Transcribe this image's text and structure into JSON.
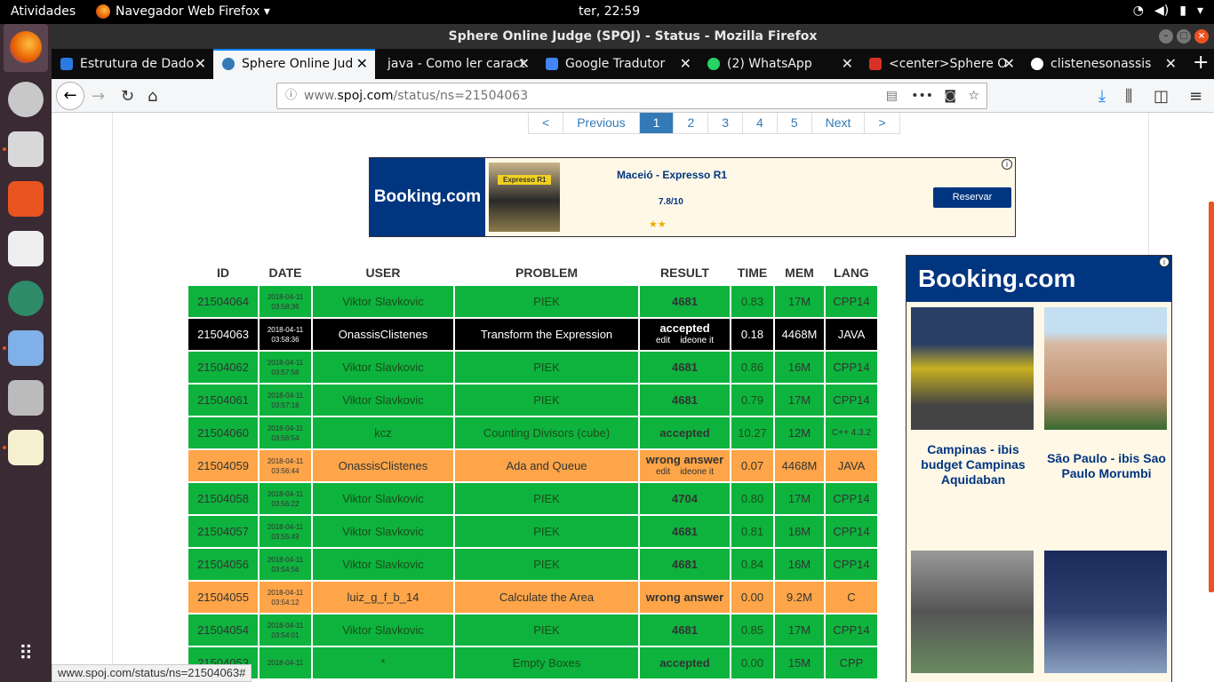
{
  "topbar": {
    "activities": "Atividades",
    "app_name": "Navegador Web Firefox ▾",
    "clock": "ter, 22:59"
  },
  "window": {
    "title": "Sphere Online Judge (SPOJ) - Status - Mozilla Firefox"
  },
  "tabs": [
    {
      "label": "Estrutura de Dado",
      "icon": "doc-icon",
      "color": "#2a7ae2"
    },
    {
      "label": "Sphere Online Jud",
      "icon": "spoj-icon",
      "color": "#337ab7",
      "active": true
    },
    {
      "label": "java - Como ler caract",
      "icon": "stackoverflow-icon",
      "color": "#0c0c0d"
    },
    {
      "label": "Google Tradutor",
      "icon": "translate-icon",
      "color": "#4285f4"
    },
    {
      "label": "(2) WhatsApp",
      "icon": "whatsapp-icon",
      "color": "#25d366"
    },
    {
      "label": "<center>Sphere O",
      "icon": "gmail-icon",
      "color": "#d93025"
    },
    {
      "label": "clistenesonassis",
      "icon": "github-icon",
      "color": "#ffffff"
    }
  ],
  "url": {
    "prefix": "www.",
    "host": "spoj.com",
    "path": "/status/ns=21504063"
  },
  "pagination": [
    "<",
    "Previous",
    "1",
    "2",
    "3",
    "4",
    "5",
    "Next",
    ">"
  ],
  "pagination_current": "1",
  "ad_top": {
    "brand": "Booking.com",
    "badge": "Expresso R1",
    "hotel": "Maceió - Expresso R1",
    "rating": "7.8/10",
    "stars": "★★",
    "button": "Reservar"
  },
  "table": {
    "headers": [
      "ID",
      "DATE",
      "USER",
      "PROBLEM",
      "RESULT",
      "TIME",
      "MEM",
      "LANG"
    ],
    "rows": [
      {
        "status": "ok",
        "id": "21504064",
        "date1": "2018-04-11",
        "date2": "03:58:36",
        "user": "Viktor Slavkovic",
        "problem": "PIEK",
        "result": "4681",
        "links": "",
        "time": "0.83",
        "mem": "17M",
        "lang": "CPP14"
      },
      {
        "status": "me",
        "id": "21504063",
        "date1": "2018-04-11",
        "date2": "03:58:36",
        "user": "OnassisClistenes",
        "problem": "Transform the Expression",
        "result": "accepted",
        "links": "edit    ideone it",
        "time": "0.18",
        "mem": "4468M",
        "lang": "JAVA"
      },
      {
        "status": "ok",
        "id": "21504062",
        "date1": "2018-04-11",
        "date2": "03:57:56",
        "user": "Viktor Slavkovic",
        "problem": "PIEK",
        "result": "4681",
        "links": "",
        "time": "0.86",
        "mem": "16M",
        "lang": "CPP14"
      },
      {
        "status": "ok",
        "id": "21504061",
        "date1": "2018-04-11",
        "date2": "03:57:18",
        "user": "Viktor Slavkovic",
        "problem": "PIEK",
        "result": "4681",
        "links": "",
        "time": "0.79",
        "mem": "17M",
        "lang": "CPP14"
      },
      {
        "status": "ok",
        "id": "21504060",
        "date1": "2018-04-11",
        "date2": "03:56:54",
        "user": "kcz",
        "problem": "Counting Divisors (cube)",
        "result": "accepted",
        "links": "",
        "time": "10.27",
        "mem": "12M",
        "lang": "C++ 4.3.2"
      },
      {
        "status": "wa",
        "id": "21504059",
        "date1": "2018-04-11",
        "date2": "03:56:44",
        "user": "OnassisClistenes",
        "problem": "Ada and Queue",
        "result": "wrong answer",
        "links": "edit    ideone it",
        "time": "0.07",
        "mem": "4468M",
        "lang": "JAVA"
      },
      {
        "status": "ok",
        "id": "21504058",
        "date1": "2018-04-11",
        "date2": "03:56:22",
        "user": "Viktor Slavkovic",
        "problem": "PIEK",
        "result": "4704",
        "links": "",
        "time": "0.80",
        "mem": "17M",
        "lang": "CPP14"
      },
      {
        "status": "ok",
        "id": "21504057",
        "date1": "2018-04-11",
        "date2": "03:55:49",
        "user": "Viktor Slavkovic",
        "problem": "PIEK",
        "result": "4681",
        "links": "",
        "time": "0.81",
        "mem": "16M",
        "lang": "CPP14"
      },
      {
        "status": "ok",
        "id": "21504056",
        "date1": "2018-04-11",
        "date2": "03:54:56",
        "user": "Viktor Slavkovic",
        "problem": "PIEK",
        "result": "4681",
        "links": "",
        "time": "0.84",
        "mem": "16M",
        "lang": "CPP14"
      },
      {
        "status": "wa",
        "id": "21504055",
        "date1": "2018-04-11",
        "date2": "03:54:12",
        "user": "luiz_g_f_b_14",
        "problem": "Calculate the Area",
        "result": "wrong answer",
        "links": "",
        "time": "0.00",
        "mem": "9.2M",
        "lang": "C"
      },
      {
        "status": "ok",
        "id": "21504054",
        "date1": "2018-04-11",
        "date2": "03:54:01",
        "user": "Viktor Slavkovic",
        "problem": "PIEK",
        "result": "4681",
        "links": "",
        "time": "0.85",
        "mem": "17M",
        "lang": "CPP14"
      },
      {
        "status": "ok",
        "id": "21504053",
        "date1": "2018-04-11",
        "date2": "",
        "user": "*",
        "problem": "Empty Boxes",
        "result": "accepted",
        "links": "",
        "time": "0.00",
        "mem": "15M",
        "lang": "CPP"
      }
    ]
  },
  "ad_side": {
    "brand": "Booking.com",
    "hotels": [
      "Campinas - ibis budget Campinas Aquidaban",
      "São Paulo - ibis Sao Paulo Morumbi"
    ]
  },
  "statusbar": "www.spoj.com/status/ns=21504063#",
  "colors": {
    "accepted": "#0db33d",
    "wrong": "#fda548",
    "mine": "#000000",
    "booking": "#003580",
    "ubuntu_orange": "#e95420"
  }
}
